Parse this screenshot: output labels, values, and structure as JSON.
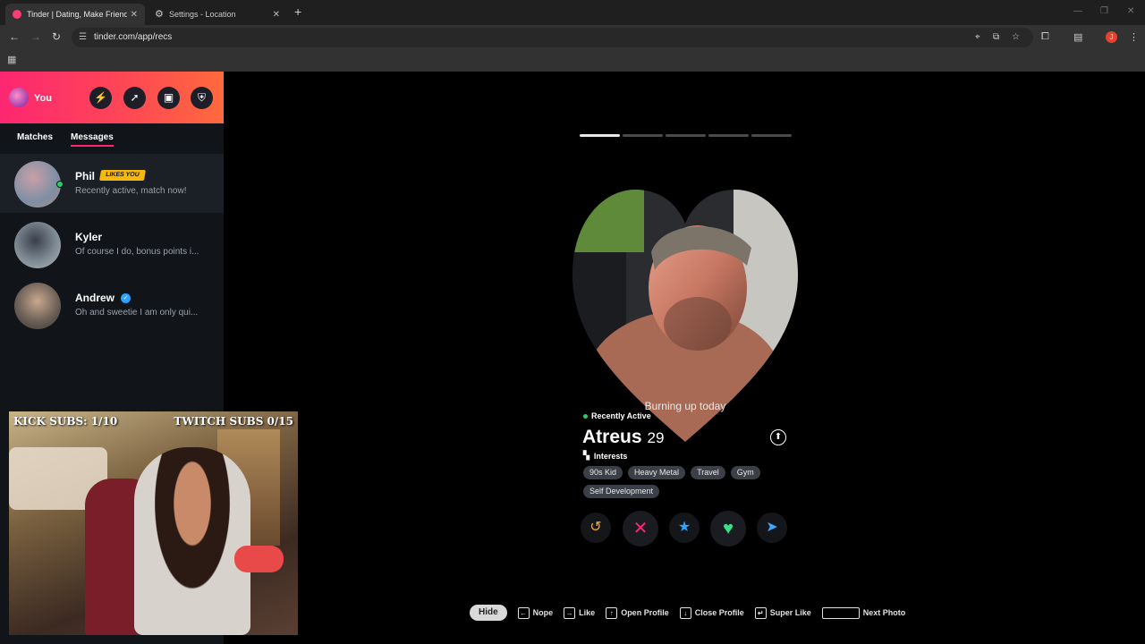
{
  "browser": {
    "tabs": [
      {
        "title": "Tinder | Dating, Make Friends &",
        "favicon_color": "#fe3c72"
      },
      {
        "title": "Settings - Location",
        "favicon_icon": "gear-icon"
      }
    ],
    "url": "tinder.com/app/recs"
  },
  "sidebar": {
    "me_label": "You",
    "header_buttons": [
      "bolt-icon",
      "compass-icon",
      "briefcase-icon",
      "shield-icon"
    ],
    "tabs": [
      "Matches",
      "Messages"
    ],
    "active_tab": "Messages",
    "conversations": [
      {
        "name": "Phil",
        "badge": "LIKES YOU",
        "message": "Recently active, match now!",
        "online": true
      },
      {
        "name": "Kyler",
        "message": "Of course I do, bonus points i..."
      },
      {
        "name": "Andrew",
        "verified": true,
        "message": "Oh and sweetie I am only qui..."
      }
    ]
  },
  "stream_overlay": {
    "kick_subs": "KICK SUBS: 1/10",
    "twitch_subs": "TWITCH SUBS 0/15"
  },
  "profile_card": {
    "photo_count": 5,
    "active_photo": 1,
    "photo_caption": "Burning up today",
    "status": "Recently Active",
    "name": "Atreus",
    "age": "29",
    "interests_label": "Interests",
    "interests": [
      "90s Kid",
      "Heavy Metal",
      "Travel",
      "Gym",
      "Self Development"
    ],
    "actions": [
      "rewind-icon",
      "nope-icon",
      "super-like-icon",
      "like-icon",
      "boost-icon"
    ]
  },
  "keyboard_hints": {
    "hide_label": "Hide",
    "items": [
      {
        "key": "←",
        "label": "Nope"
      },
      {
        "key": "→",
        "label": "Like"
      },
      {
        "key": "↑",
        "label": "Open Profile"
      },
      {
        "key": "↓",
        "label": "Close Profile"
      },
      {
        "key": "↵",
        "label": "Super Like"
      },
      {
        "key": "",
        "label": "Next Photo"
      }
    ]
  },
  "colors": {
    "brand_gradient_start": "#fd2671",
    "brand_gradient_end": "#ff6a3d",
    "online": "#24d065",
    "badge": "#f5b80b"
  }
}
